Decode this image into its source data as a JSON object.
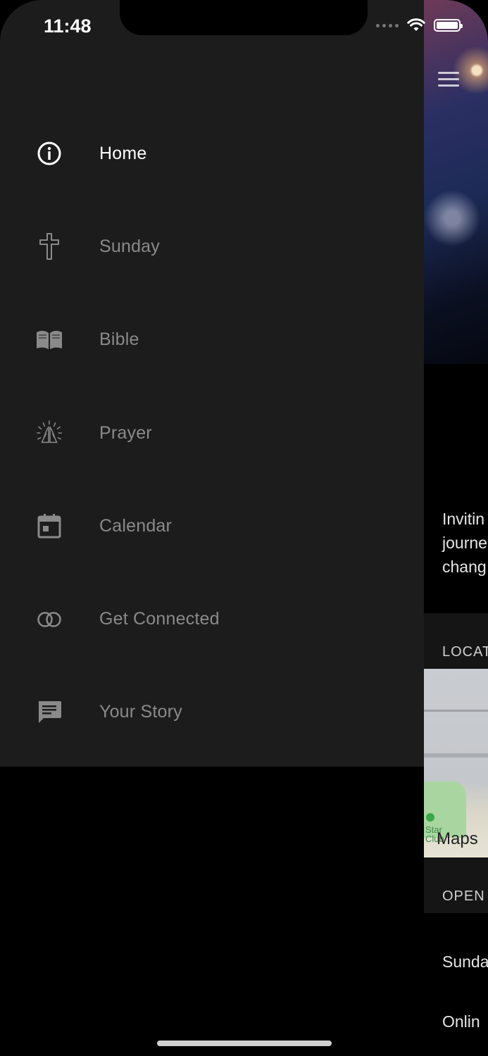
{
  "status_bar": {
    "time": "11:48"
  },
  "drawer": {
    "items": [
      {
        "label": "Home",
        "icon": "info-icon",
        "active": true
      },
      {
        "label": "Sunday",
        "icon": "cross-icon",
        "active": false
      },
      {
        "label": "Bible",
        "icon": "book-icon",
        "active": false
      },
      {
        "label": "Prayer",
        "icon": "praying-hands-icon",
        "active": false
      },
      {
        "label": "Calendar",
        "icon": "calendar-icon",
        "active": false
      },
      {
        "label": "Get Connected",
        "icon": "rings-icon",
        "active": false
      },
      {
        "label": "Your Story",
        "icon": "chat-icon",
        "active": false
      }
    ]
  },
  "background": {
    "hero_menu_icon": "hamburger-icon",
    "intro_lines": [
      "Invitin",
      "journe",
      "chang"
    ],
    "location_heading": "LOCAT",
    "map_poi_label": [
      "Star",
      "Club"
    ],
    "map_brand": "Maps",
    "open_heading": "OPEN",
    "schedule": [
      "Sunda",
      "Onlin"
    ]
  },
  "colors": {
    "drawer_bg": "#1c1c1c",
    "active_text": "#ffffff",
    "inactive_text": "#8a8a8a",
    "screen_bg": "#000000"
  }
}
